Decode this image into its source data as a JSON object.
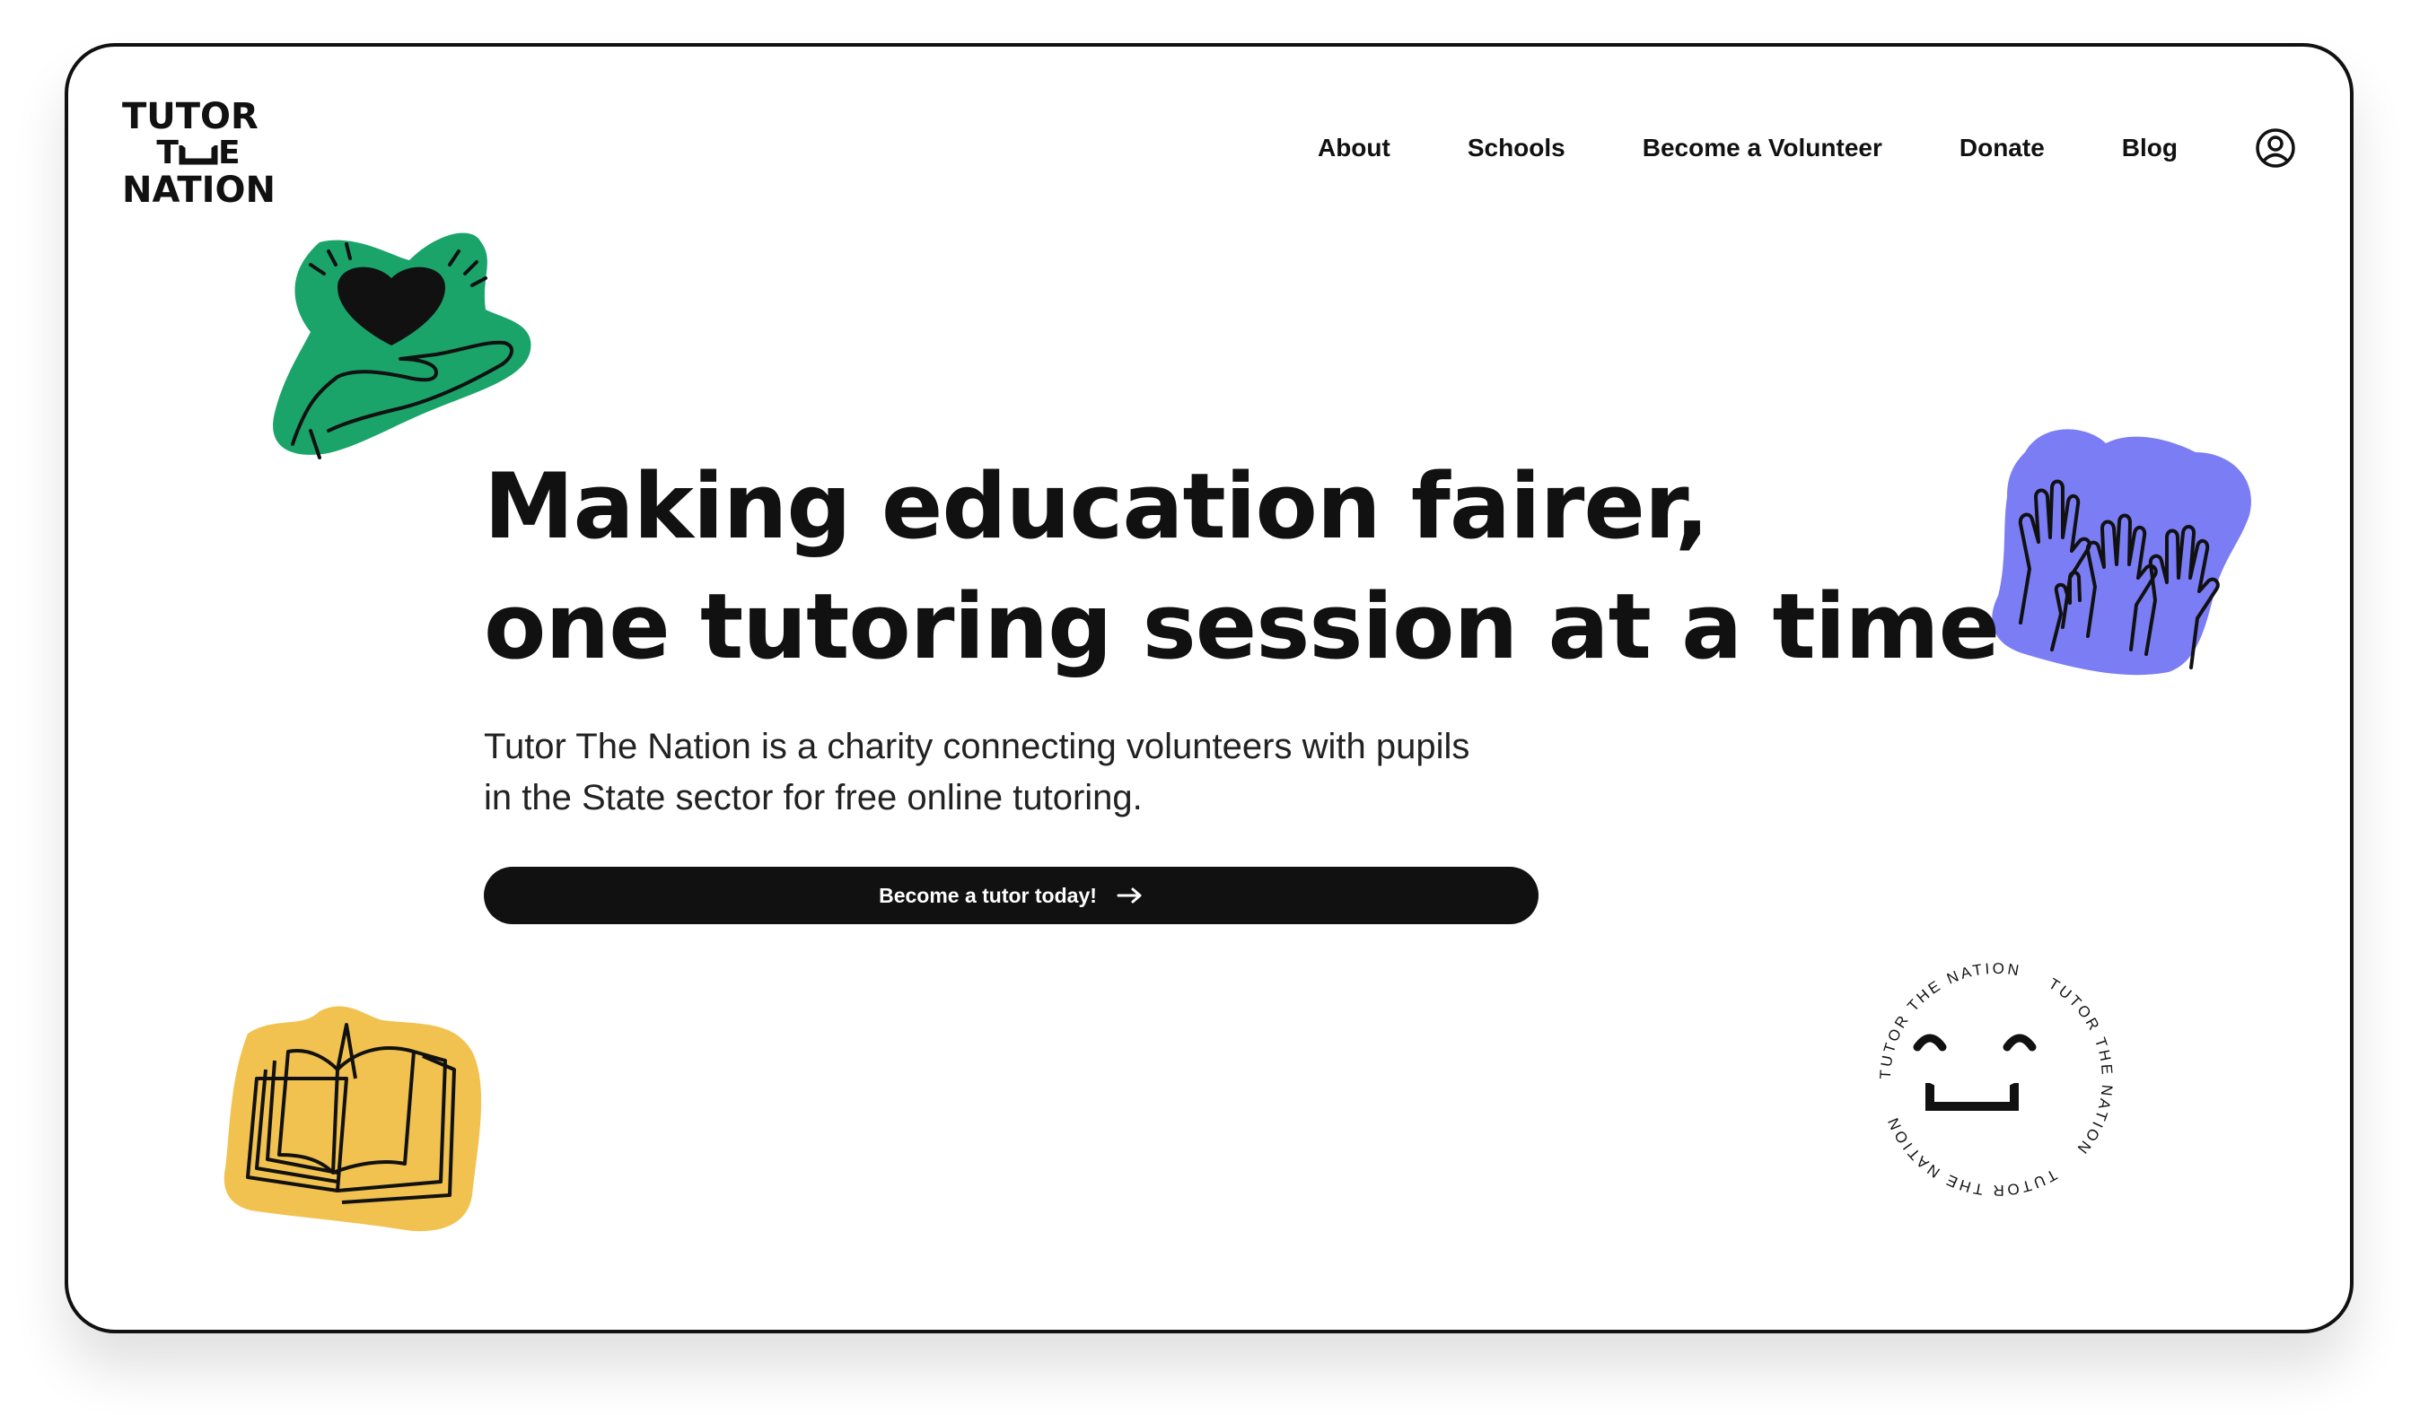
{
  "brand": {
    "logo_line1": "TUTOR",
    "logo_line2_left": "T",
    "logo_line2_right": "E",
    "logo_line3": "NATION"
  },
  "nav": {
    "items": [
      {
        "label": "About"
      },
      {
        "label": "Schools"
      },
      {
        "label": "Become a Volunteer"
      },
      {
        "label": "Donate"
      },
      {
        "label": "Blog"
      }
    ],
    "account_icon": "user-circle-icon"
  },
  "hero": {
    "title_line1": "Making education fairer,",
    "title_line2": "one tutoring session at a time",
    "subtitle_line1": "Tutor The Nation is a charity connecting volunteers with pupils",
    "subtitle_line2": "in the State sector for free online tutoring.",
    "cta_label": "Become a tutor today!",
    "cta_icon": "arrow-right-icon"
  },
  "stickers": {
    "heart_hand": {
      "icon": "heart-in-hand-icon",
      "color": "#1aa46a"
    },
    "raised_hands": {
      "icon": "raised-hands-icon",
      "color": "#7b7df5"
    },
    "open_book": {
      "icon": "open-book-icon",
      "color": "#f1c24f"
    },
    "smile_stamp": {
      "icon": "smile-badge-icon",
      "ring_text": "TUTOR THE NATION"
    }
  },
  "colors": {
    "ink": "#111111",
    "background": "#ffffff"
  }
}
